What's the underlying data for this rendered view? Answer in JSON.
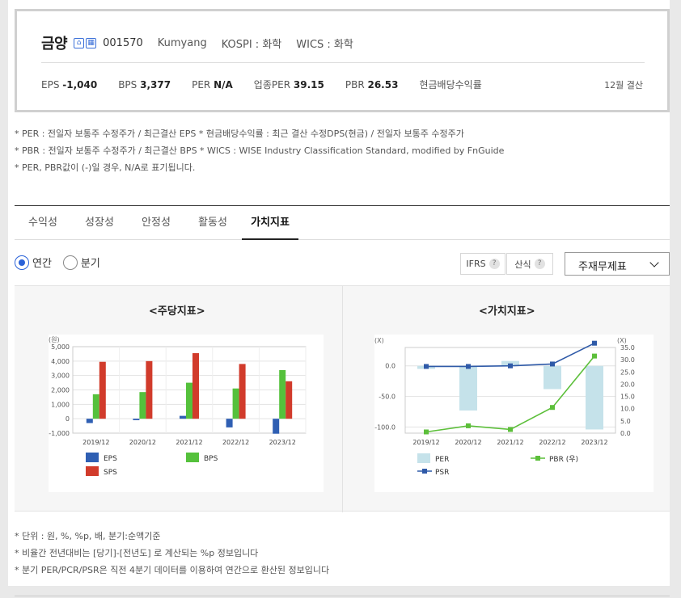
{
  "corp": {
    "name": "금양",
    "code": "001570",
    "eng_name": "Kumyang",
    "market": "KOSPI : 화학",
    "wics": "WICS : 화학",
    "settle": "12월 결산"
  },
  "stats": [
    {
      "label": "EPS",
      "value": "-1,040"
    },
    {
      "label": "BPS",
      "value": "3,377"
    },
    {
      "label": "PER",
      "value": "N/A"
    },
    {
      "label": "업종PER",
      "value": "39.15"
    },
    {
      "label": "PBR",
      "value": "26.53"
    },
    {
      "label": "현금배당수익률",
      "value": ""
    }
  ],
  "notes_top": [
    "* PER : 전일자 보통주 수정주가 / 최근결산 EPS * 현금배당수익률 : 최근 결산 수정DPS(현금) / 전일자 보통주 수정주가",
    "* PBR : 전일자 보통주 수정주가 / 최근결산 BPS * WICS : WISE Industry Classification Standard, modified by FnGuide",
    "* PER, PBR값이 (-)일 경우, N/A로 표기됩니다."
  ],
  "tabs": [
    "수익성",
    "성장성",
    "안정성",
    "활동성",
    "가치지표"
  ],
  "active_tab": "가치지표",
  "period": {
    "annual": "연간",
    "quarter": "분기",
    "selected": "연간"
  },
  "options": {
    "ifrs": "IFRS",
    "calc": "산식",
    "q_mark": "?",
    "select": "주재무제표"
  },
  "notes_bottom": [
    "* 단위 : 원, %, %p, 배, 분기:순액기준",
    "* 비율간 전년대비는 [당기]-[전년도] 로 계산되는 %p 정보입니다",
    "* 분기 PER/PCR/PSR은 직전 4분기 데이터를 이용하여 연간으로 환산된 정보입니다"
  ],
  "colors": {
    "eps": "#2f5fb3",
    "bps": "#55c13c",
    "sps": "#d13b2b",
    "per": "#c5e2ea",
    "pbr": "#5cbf3a",
    "psr": "#2f5aa8",
    "radio": "#2a62d8"
  },
  "chart_data": [
    {
      "type": "bar",
      "title": "<주당지표>",
      "unit_label": "(원)",
      "categories": [
        "2019/12",
        "2020/12",
        "2021/12",
        "2022/12",
        "2023/12"
      ],
      "ylim": [
        -1000,
        5000
      ],
      "yticks": [
        "5,000",
        "4,000",
        "3,000",
        "2,000",
        "1,000",
        "0",
        "-1,000"
      ],
      "series": [
        {
          "name": "EPS",
          "values": [
            -300,
            -100,
            200,
            -600,
            -1040
          ]
        },
        {
          "name": "BPS",
          "values": [
            1700,
            1850,
            2500,
            2100,
            3377
          ]
        },
        {
          "name": "SPS",
          "values": [
            3950,
            4000,
            4550,
            3800,
            2600
          ]
        }
      ],
      "grid": true
    },
    {
      "type": "bar",
      "title": "<가치지표>",
      "unit_left": "(X)",
      "unit_right": "(X)",
      "categories": [
        "2019/12",
        "2020/12",
        "2021/12",
        "2022/12",
        "2023/12"
      ],
      "ylim_left": [
        -110,
        30
      ],
      "yticks_left": [
        "0.0",
        "-50.0",
        "-100.0"
      ],
      "ylim_right": [
        0,
        35
      ],
      "yticks_right": [
        "35.0",
        "30.0",
        "25.0",
        "20.0",
        "15.0",
        "10.0",
        "5.0",
        "0.0"
      ],
      "series": [
        {
          "name": "PER",
          "axis": "left",
          "type": "bar",
          "values": [
            -5,
            -73,
            8,
            -38,
            -104
          ]
        },
        {
          "name": "PSR",
          "axis": "left",
          "type": "line",
          "values": [
            -1,
            -1,
            0,
            3,
            37
          ]
        },
        {
          "name": "PBR (우)",
          "axis": "right",
          "type": "line",
          "values": [
            0.5,
            3,
            1.5,
            10.5,
            31.5
          ]
        }
      ],
      "grid": true
    }
  ]
}
